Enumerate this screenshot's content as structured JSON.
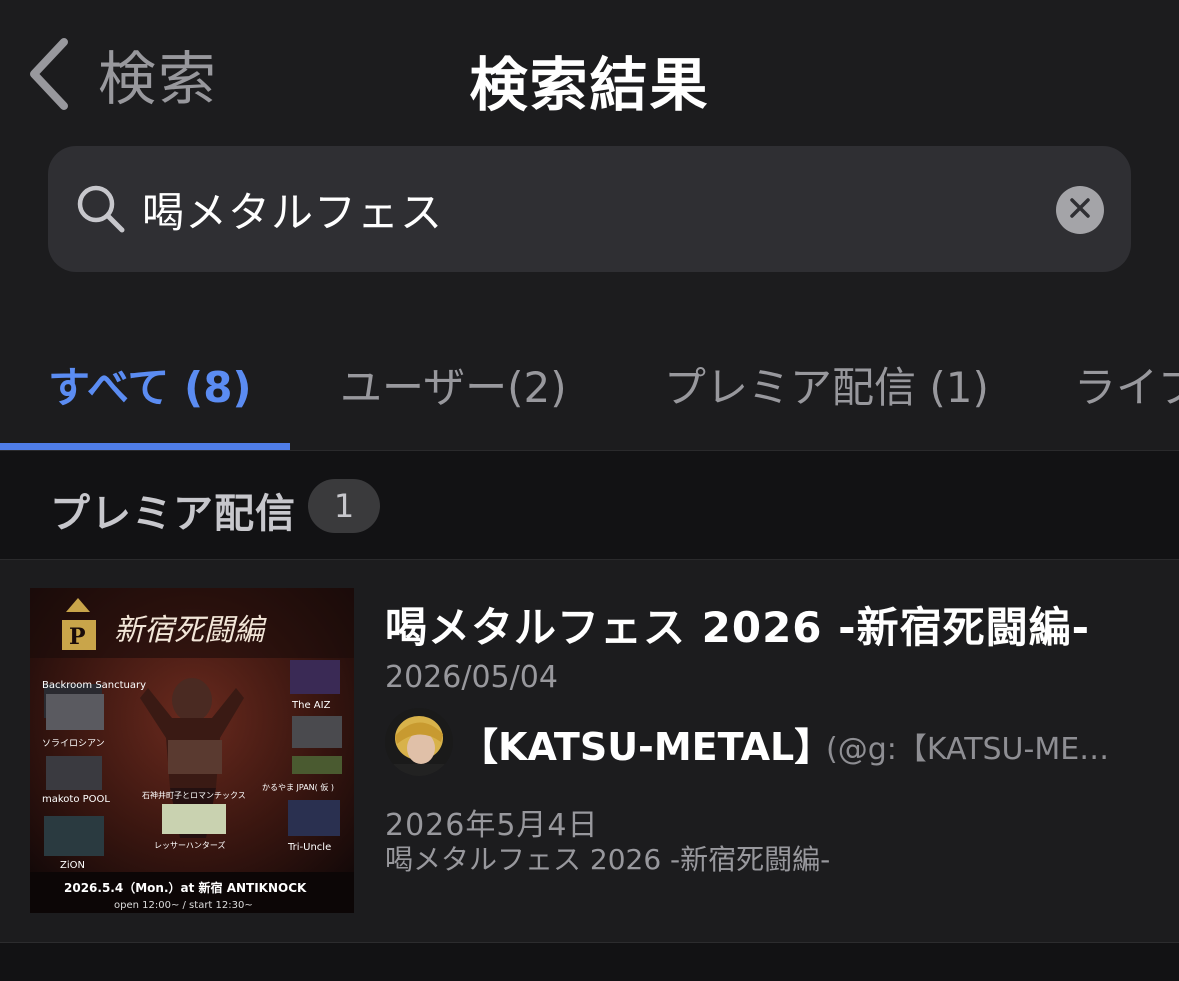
{
  "nav": {
    "back_label": "検索",
    "title": "検索結果"
  },
  "search": {
    "query": "喝メタルフェス",
    "placeholder": ""
  },
  "tabs": [
    {
      "label": "すべて (8)",
      "active": true
    },
    {
      "label": "ユーザー(2)",
      "active": false
    },
    {
      "label": "プレミア配信 (1)",
      "active": false
    },
    {
      "label": "ライブ",
      "active": false
    }
  ],
  "section": {
    "title": "プレミア配信",
    "count": "1"
  },
  "result": {
    "title": "喝メタルフェス 2026 -新宿死闘編-",
    "date": "2026/05/04",
    "user_name": "【KATSU-METAL】",
    "handle": "(@g:【KATSU-ME…",
    "desc_date": "2026年5月4日",
    "desc_title": "喝メタルフェス 2026 -新宿死闘編-",
    "poster": {
      "heading": "新宿死闘編",
      "logo": "P",
      "bands": [
        "Backroom Sanctuary",
        "The AIZ",
        "ソライロシアン",
        "石神井町子とロマンチックス",
        "makoto POOL",
        "かるやま JPAN( 仮 )",
        "ZiON",
        "レッサーハンターズ",
        "Tri-Uncle"
      ],
      "date_venue": "2026.5.4（Mon.）at 新宿 ANTIKNOCK",
      "times": "open 12:00~ / start 12:30~"
    }
  },
  "colors": {
    "background": "#1c1c1e",
    "accent": "#5b8cf2",
    "search_field": "#2f2f33",
    "section_bg": "#121214",
    "secondary_text": "#98989d"
  }
}
